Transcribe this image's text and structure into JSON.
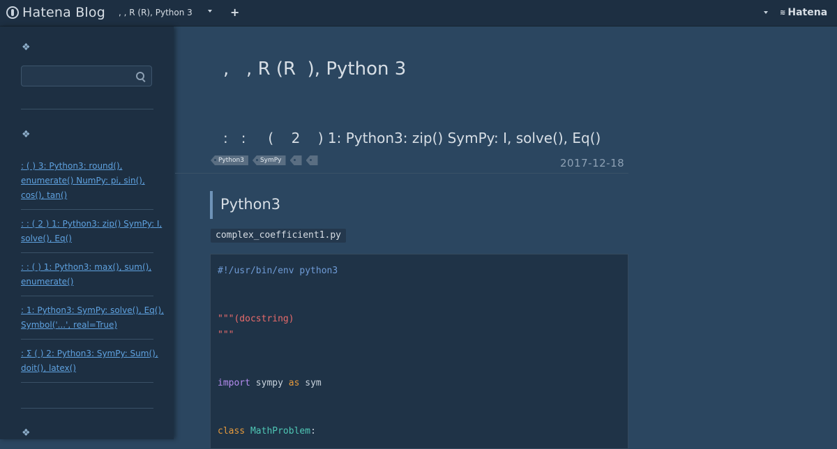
{
  "topbar": {
    "logo_text": "Hatena Blog",
    "blog_switcher": ", , R (R), Python 3",
    "add_label": "+",
    "brand": "Hatena"
  },
  "sidebar": {
    "deco_glyph": "❖",
    "search_placeholder": "",
    "recent_entries": [
      "   :     (      ) 3: Python3: round(), enumerate() NumPy: pi, sin(), cos(), tan()",
      "   :   :     (    2    ) 1: Python3: zip() SymPy: I, solve(), Eq()",
      "   :   :     (            ) 1: Python3: max(), sum(), enumerate()",
      "   :       1: Python3: SymPy: solve(), Eq(), Symbol('...', real=True)",
      "   : Σ (    )     2: Python3: SymPy: Sum(), doit(), latex()"
    ]
  },
  "main": {
    "blog_title": ",   , R (R  ), Python 3",
    "entry_title": ":   :     (    2    ) 1: Python3: zip() SymPy: I, solve(), Eq()",
    "tags": [
      "Python3",
      "SymPy",
      "",
      ""
    ],
    "date": "2017-12-18",
    "section_heading": "Python3",
    "file_name": "complex_coefficient1.py",
    "code": {
      "shebang": "#!/usr/bin/env python3",
      "docstring_open": "\"\"\"(docstring)",
      "docstring_close": "\"\"\"",
      "kw_import": "import",
      "import_module": " sympy ",
      "kw_as": "as",
      "import_alias": " sym",
      "kw_class": "class",
      "class_name": "MathProblem",
      "class_colon": ":"
    }
  },
  "colors": {
    "background": "#2b4660",
    "sidebar": "#1d2f42",
    "link": "#5fa2e0",
    "code_string": "#e86b6b",
    "code_keyword": "#b58cf0"
  }
}
